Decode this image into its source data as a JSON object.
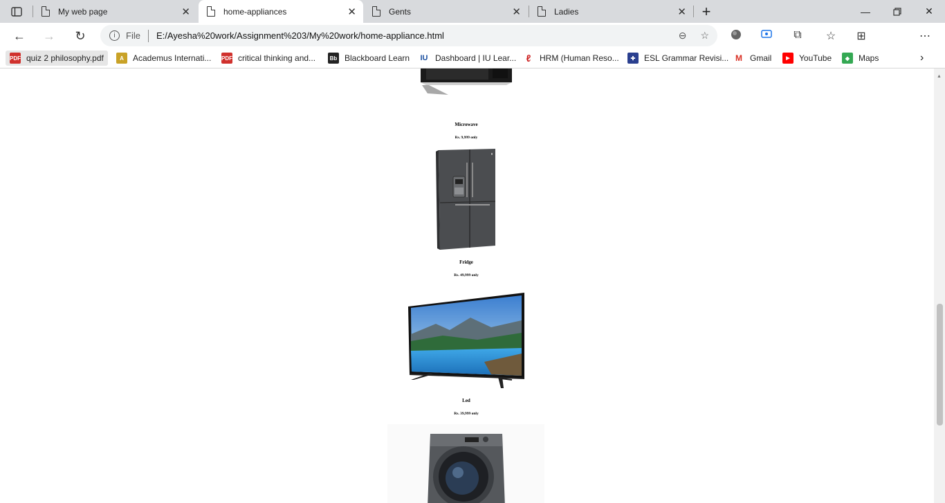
{
  "tabs": [
    {
      "title": "My web page",
      "active": false
    },
    {
      "title": "home-appliances",
      "active": true
    },
    {
      "title": "Gents",
      "active": false
    },
    {
      "title": "Ladies",
      "active": false
    }
  ],
  "address": {
    "scheme_label": "File",
    "url": "E:/Ayesha%20work/Assignment%203/My%20work/home-appliance.html"
  },
  "bookmarks": [
    {
      "label": "quiz 2 philosophy.pdf",
      "icon": "pdf-icon",
      "color": "#d0312d"
    },
    {
      "label": "Academus Internati...",
      "icon": "academus-icon",
      "color": "#c9a227"
    },
    {
      "label": "critical thinking and...",
      "icon": "pdf-icon",
      "color": "#d0312d"
    },
    {
      "label": "Blackboard Learn",
      "icon": "blackboard-icon",
      "color": "#222222"
    },
    {
      "label": "Dashboard | IU Lear...",
      "icon": "iu-icon",
      "color": "#1a4fa0"
    },
    {
      "label": "HRM (Human Reso...",
      "icon": "hrm-icon",
      "color": "#cc1f1f"
    },
    {
      "label": "ESL Grammar Revisi...",
      "icon": "uk-flag-icon",
      "color": "#2a3f8f"
    },
    {
      "label": "Gmail",
      "icon": "gmail-icon",
      "color": "#d93025"
    },
    {
      "label": "YouTube",
      "icon": "youtube-icon",
      "color": "#ff0000"
    },
    {
      "label": "Maps",
      "icon": "maps-icon",
      "color": "#34a853"
    }
  ],
  "products": [
    {
      "name": "Microwave",
      "price": "Rs. 9,999 only"
    },
    {
      "name": "Fridge",
      "price": "Rs. 49,999 only"
    },
    {
      "name": "Led",
      "price": "Rs. 39,999 only"
    }
  ]
}
